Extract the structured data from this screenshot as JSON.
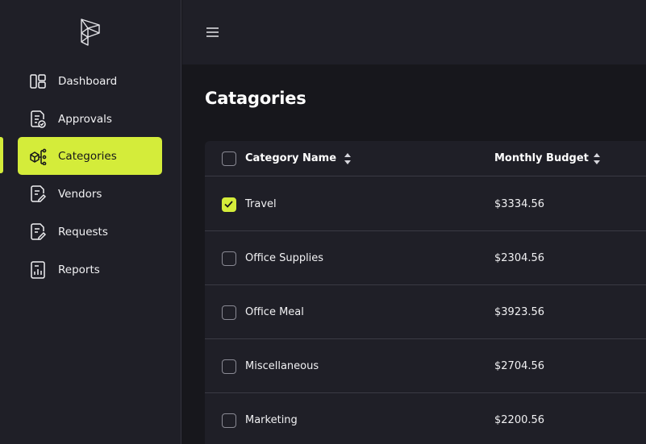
{
  "colors": {
    "accent": "#d4ec3a",
    "sidebar_bg": "#1f1f27",
    "page_bg": "#17171c"
  },
  "sidebar": {
    "items": [
      {
        "label": "Dashboard",
        "icon": "dashboard-icon",
        "active": false
      },
      {
        "label": "Approvals",
        "icon": "approvals-icon",
        "active": false
      },
      {
        "label": "Categories",
        "icon": "categories-icon",
        "active": true
      },
      {
        "label": "Vendors",
        "icon": "vendors-icon",
        "active": false
      },
      {
        "label": "Requests",
        "icon": "requests-icon",
        "active": false
      },
      {
        "label": "Reports",
        "icon": "reports-icon",
        "active": false
      }
    ]
  },
  "page": {
    "title": "Catagories"
  },
  "table": {
    "columns": [
      "Category Name",
      "Monthly Budget"
    ],
    "rows": [
      {
        "name": "Travel",
        "budget": "$3334.56",
        "checked": true
      },
      {
        "name": "Office Supplies",
        "budget": "$2304.56",
        "checked": false
      },
      {
        "name": "Office Meal",
        "budget": "$3923.56",
        "checked": false
      },
      {
        "name": "Miscellaneous",
        "budget": "$2704.56",
        "checked": false
      },
      {
        "name": "Marketing",
        "budget": "$2200.56",
        "checked": false
      }
    ]
  }
}
